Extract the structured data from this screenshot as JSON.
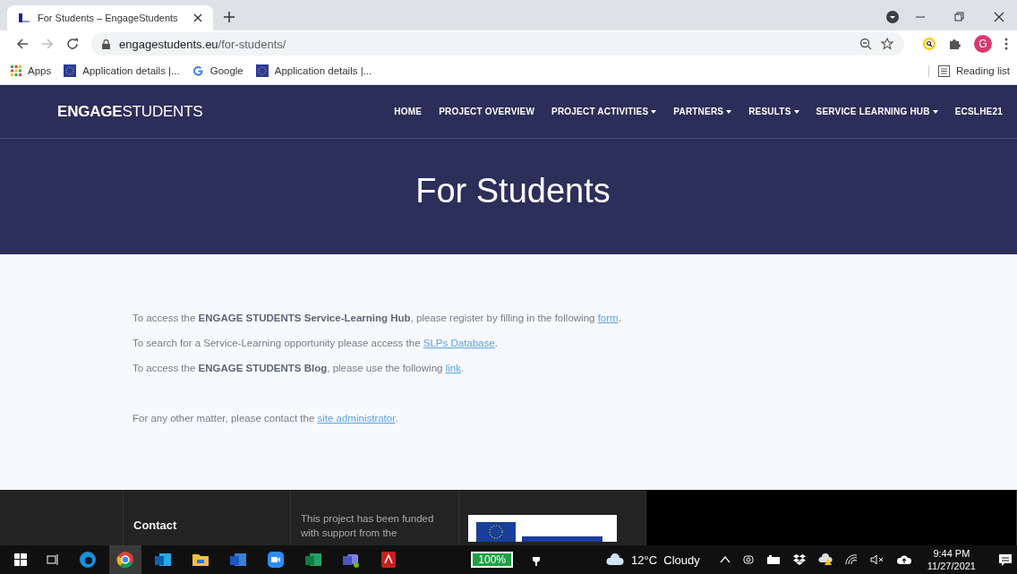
{
  "browser": {
    "tab": {
      "title": "For Students – EngageStudents",
      "selected": true
    },
    "url": {
      "domain": "engagestudents.eu",
      "path": "/for-students/"
    },
    "profile_initial": "G",
    "bookmarks": [
      {
        "kind": "apps",
        "label": "Apps"
      },
      {
        "kind": "eu",
        "label": "Application details |..."
      },
      {
        "kind": "google",
        "label": "Google"
      },
      {
        "kind": "eu",
        "label": "Application details |..."
      }
    ],
    "reading_list": "Reading list"
  },
  "site": {
    "logo_bold": "ENGAGE",
    "logo_light": "STUDENTS",
    "nav": [
      {
        "label": "HOME",
        "dropdown": false
      },
      {
        "label": "PROJECT OVERVIEW",
        "dropdown": false
      },
      {
        "label": "PROJECT ACTIVITIES",
        "dropdown": true
      },
      {
        "label": "PARTNERS",
        "dropdown": true
      },
      {
        "label": "RESULTS",
        "dropdown": true
      },
      {
        "label": "SERVICE LEARNING HUB",
        "dropdown": true
      },
      {
        "label": "ECSLHE21",
        "dropdown": false
      }
    ],
    "page_title": "For Students",
    "paragraphs": [
      {
        "parts": [
          {
            "kind": "text",
            "text": "To access the "
          },
          {
            "kind": "bold",
            "text": "ENGAGE STUDENTS Service-Learning Hub"
          },
          {
            "kind": "text",
            "text": ", please register by filling in the following "
          },
          {
            "kind": "link",
            "text": "form"
          },
          {
            "kind": "text",
            "text": "."
          }
        ]
      },
      {
        "parts": [
          {
            "kind": "text",
            "text": "To search for a Service-Learning opportunity please access the "
          },
          {
            "kind": "link",
            "text": "SLPs Database"
          },
          {
            "kind": "text",
            "text": "."
          }
        ]
      },
      {
        "parts": [
          {
            "kind": "text",
            "text": "To access the "
          },
          {
            "kind": "bold",
            "text": "ENGAGE STUDENTS Blog"
          },
          {
            "kind": "text",
            "text": ", please use the following "
          },
          {
            "kind": "link",
            "text": "link"
          },
          {
            "kind": "text",
            "text": "."
          }
        ]
      }
    ],
    "contact_note": [
      {
        "parts": [
          {
            "kind": "text",
            "text": "For any other matter, please contact the "
          },
          {
            "kind": "link",
            "text": "site administrator"
          },
          {
            "kind": "text",
            "text": "."
          }
        ]
      }
    ],
    "footer": {
      "contact_heading": "Contact",
      "funding_lines": [
        "This project has been funded",
        "with support from the"
      ]
    }
  },
  "taskbar": {
    "battery": "100%",
    "weather": "12°C  Cloudy",
    "time": "9:44 PM",
    "date": "11/27/2021"
  }
}
